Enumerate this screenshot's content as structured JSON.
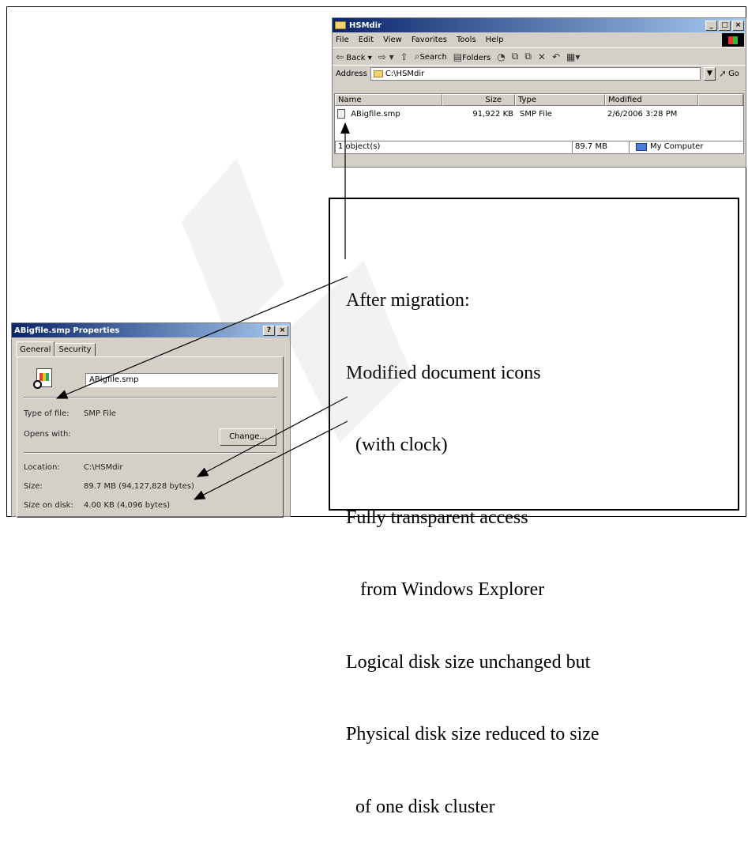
{
  "explorer": {
    "title": "HSMdir",
    "menu": [
      "File",
      "Edit",
      "View",
      "Favorites",
      "Tools",
      "Help"
    ],
    "toolbar": {
      "back": "Back",
      "search": "Search",
      "folders": "Folders"
    },
    "address_label": "Address",
    "address_value": "C:\\HSMdir",
    "go_label": "Go",
    "columns": [
      "Name",
      "Size",
      "Type",
      "Modified"
    ],
    "files": [
      {
        "name": "ABigfile.smp",
        "size": "91,922 KB",
        "type": "SMP File",
        "modified": "2/6/2006 3:28 PM"
      }
    ],
    "status": {
      "objects": "1 object(s)",
      "size": "89.7 MB",
      "location": "My Computer"
    }
  },
  "properties": {
    "title": "ABigfile.smp Properties",
    "help_btn": "?",
    "close_btn": "×",
    "tabs": [
      "General",
      "Security"
    ],
    "filename": "ABigfile.smp",
    "type_label": "Type of file:",
    "type_value": "SMP File",
    "opens_label": "Opens with:",
    "change_btn": "Change...",
    "location_label": "Location:",
    "location_value": "C:\\HSMdir",
    "size_label": "Size:",
    "size_value": "89.7 MB (94,127,828 bytes)",
    "sizeondisk_label": "Size on disk:",
    "sizeondisk_value": "4.00 KB (4,096 bytes)"
  },
  "callout": {
    "lines": [
      "After migration:",
      "Modified document icons",
      "  (with clock)",
      "Fully transparent access",
      "   from Windows Explorer",
      "Logical disk size unchanged but",
      "Physical disk size reduced to size",
      "  of one disk cluster"
    ]
  },
  "colors": {
    "window_face": "#d4d0c8",
    "titlebar_start": "#0a246a",
    "titlebar_end": "#a6caf0"
  }
}
